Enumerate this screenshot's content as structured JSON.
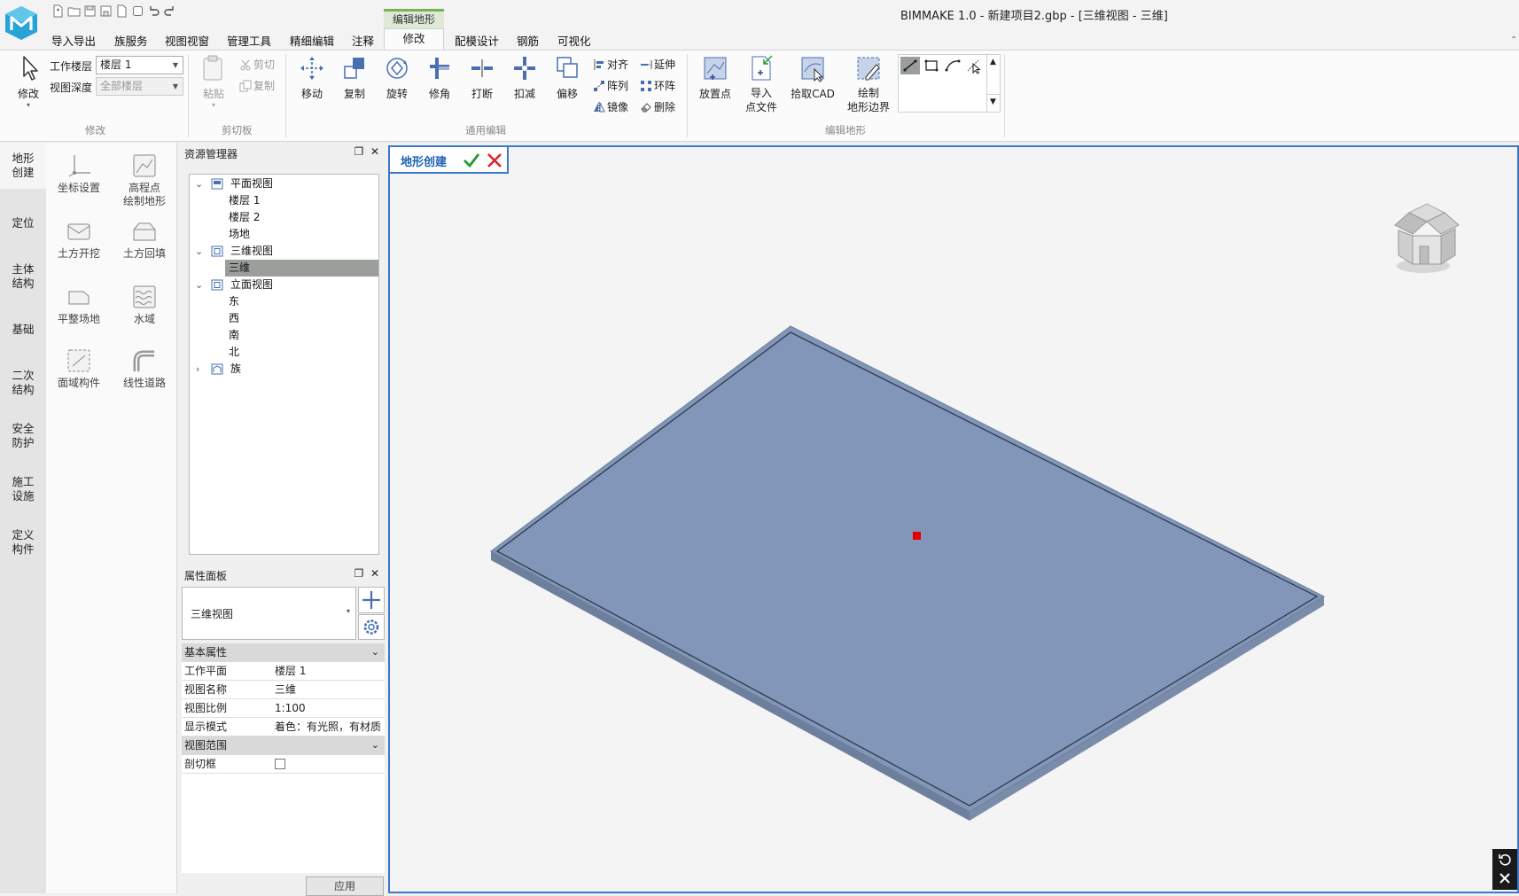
{
  "app_title": "BIMMAKE 1.0 - 新建项目2.gbp - [三维视图 - 三维]",
  "context_tab_header": "编辑地形",
  "menu": [
    "导入导出",
    "族服务",
    "视图视窗",
    "管理工具",
    "精细编辑",
    "注释",
    "修改",
    "配模设计",
    "钢筋",
    "可视化"
  ],
  "ribbon": {
    "modify": {
      "button": "修改",
      "work_floor_label": "工作楼层",
      "work_floor_value": "楼层 1",
      "view_depth_label": "视图深度",
      "view_depth_value": "全部楼层",
      "group": "修改"
    },
    "clipboard": {
      "paste": "粘贴",
      "cut": "剪切",
      "copy": "复制",
      "group": "剪切板"
    },
    "general": {
      "move": "移动",
      "duplicate": "复制",
      "rotate": "旋转",
      "trim": "修角",
      "break": "打断",
      "subtract": "扣减",
      "offset": "偏移",
      "align": "对齐",
      "extend": "延伸",
      "array": "阵列",
      "ring_array": "环阵",
      "mirror": "镜像",
      "delete": "删除",
      "group": "通用编辑"
    },
    "terrain": {
      "place_point": "放置点",
      "import_points_1": "导入",
      "import_points_2": "点文件",
      "pick_cad": "拾取CAD",
      "draw_boundary_1": "绘制",
      "draw_boundary_2": "地形边界",
      "group": "编辑地形"
    }
  },
  "vtabs": [
    {
      "l1": "地形",
      "l2": "创建"
    },
    {
      "l1": "定位",
      "l2": ""
    },
    {
      "l1": "主体",
      "l2": "结构"
    },
    {
      "l1": "基础",
      "l2": ""
    },
    {
      "l1": "二次",
      "l2": "结构"
    },
    {
      "l1": "安全",
      "l2": "防护"
    },
    {
      "l1": "施工",
      "l2": "设施"
    },
    {
      "l1": "定义",
      "l2": "构件"
    }
  ],
  "tools": [
    {
      "l1": "坐标设置",
      "l2": ""
    },
    {
      "l1": "高程点",
      "l2": "绘制地形"
    },
    {
      "l1": "土方开挖",
      "l2": ""
    },
    {
      "l1": "土方回填",
      "l2": ""
    },
    {
      "l1": "平整场地",
      "l2": ""
    },
    {
      "l1": "水域",
      "l2": ""
    },
    {
      "l1": "面域构件",
      "l2": ""
    },
    {
      "l1": "线性道路",
      "l2": ""
    }
  ],
  "resource_manager": {
    "title": "资源管理器",
    "tree": [
      "平面视图",
      "楼层 1",
      "楼层 2",
      "场地",
      "三维视图",
      "三维",
      "立面视图",
      "东",
      "西",
      "南",
      "北",
      "族"
    ]
  },
  "properties": {
    "title": "属性面板",
    "type": "三维视图",
    "section_basic": "基本属性",
    "rows": [
      {
        "k": "工作平面",
        "v": "楼层 1"
      },
      {
        "k": "视图名称",
        "v": "三维"
      },
      {
        "k": "视图比例",
        "v": "1:100"
      },
      {
        "k": "显示模式",
        "v": "着色：有光照，有材质"
      }
    ],
    "section_range": "视图范围",
    "section_box": "剖切框",
    "apply": "应用"
  },
  "viewport": {
    "command": "地形创建"
  },
  "colors": {
    "accent": "#3c78c8",
    "terrain": "#8196b8",
    "terrain_edge": "#6d809f",
    "marker": "#e60000",
    "confirm": "#1e9e2e",
    "cancel": "#d9262c"
  }
}
